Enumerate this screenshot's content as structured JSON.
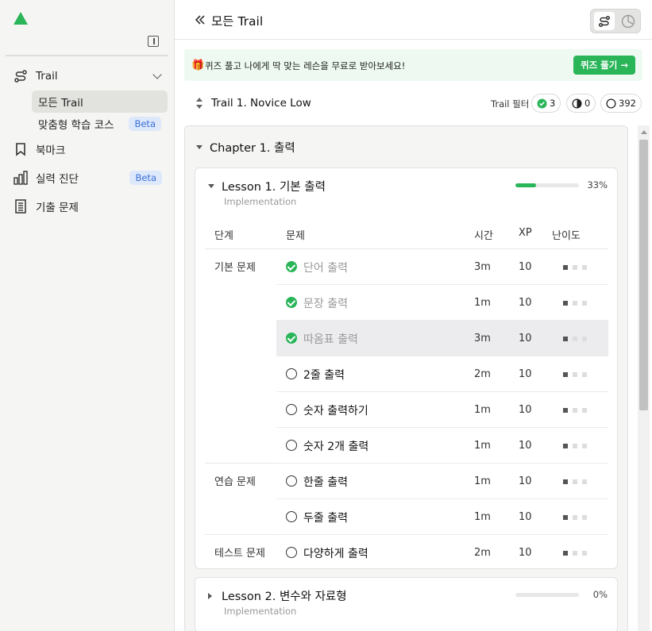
{
  "sidebar": {
    "items": [
      {
        "label": "Trail",
        "icon": "trail-icon"
      },
      {
        "label": "북마크",
        "icon": "bookmark-icon"
      },
      {
        "label": "실력 진단",
        "icon": "chart-icon",
        "badge": "Beta"
      },
      {
        "label": "기출 문제",
        "icon": "document-icon"
      }
    ],
    "sub_items": [
      {
        "label": "모든 Trail",
        "active": true
      },
      {
        "label": "맞춤형 학습 코스",
        "badge": "Beta"
      }
    ]
  },
  "header": {
    "title": "모든 Trail"
  },
  "banner": {
    "text": "퀴즈 풀고 나에게 딱 맞는 레슨을 무료로 받아보세요!",
    "button": "퀴즈 풀기 →"
  },
  "trail": {
    "name": "Trail 1. Novice Low",
    "filter_label": "Trail 필터",
    "filters": [
      {
        "count": "3",
        "type": "done"
      },
      {
        "count": "0",
        "type": "half"
      },
      {
        "count": "392",
        "type": "todo"
      }
    ]
  },
  "chapter": {
    "title": "Chapter 1. 출력",
    "lessons": [
      {
        "title": "Lesson 1. 기본 출력",
        "subtitle": "Implementation",
        "progress_pct": 33,
        "progress_label": "33%",
        "columns": [
          "단계",
          "문제",
          "시간",
          "XP",
          "난이도"
        ],
        "stages": [
          "기본 문제",
          "연습 문제",
          "테스트 문제"
        ],
        "problems": [
          {
            "title": "단어 출력",
            "time": "3m",
            "xp": "10",
            "done": true,
            "difficulty": 1
          },
          {
            "title": "문장 출력",
            "time": "1m",
            "xp": "10",
            "done": true,
            "difficulty": 1
          },
          {
            "title": "따옴표 출력",
            "time": "3m",
            "xp": "10",
            "done": true,
            "difficulty": 1
          },
          {
            "title": "2줄 출력",
            "time": "2m",
            "xp": "10",
            "done": false,
            "difficulty": 1
          },
          {
            "title": "숫자 출력하기",
            "time": "1m",
            "xp": "10",
            "done": false,
            "difficulty": 1
          },
          {
            "title": "숫자 2개 출력",
            "time": "1m",
            "xp": "10",
            "done": false,
            "difficulty": 1
          },
          {
            "title": "한줄 출력",
            "time": "1m",
            "xp": "10",
            "done": false,
            "difficulty": 1
          },
          {
            "title": "두줄 출력",
            "time": "1m",
            "xp": "10",
            "done": false,
            "difficulty": 1
          },
          {
            "title": "다양하게 출력",
            "time": "2m",
            "xp": "10",
            "done": false,
            "difficulty": 1
          }
        ]
      },
      {
        "title": "Lesson 2. 변수와 자료형",
        "subtitle": "Implementation",
        "progress_pct": 0,
        "progress_label": "0%"
      }
    ]
  },
  "colors": {
    "accent": "#2ab559",
    "beta_bg": "#dde8fb",
    "beta_text": "#3a6fd8"
  }
}
